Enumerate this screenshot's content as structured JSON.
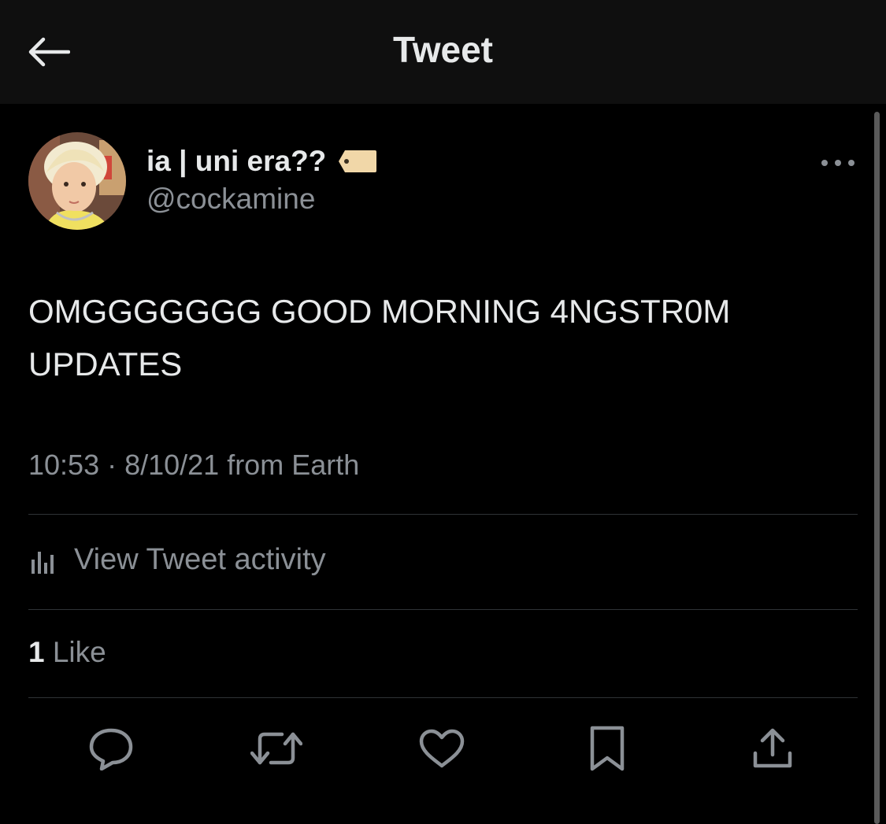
{
  "header": {
    "title": "Tweet",
    "back_icon": "arrow-left-icon"
  },
  "tweet": {
    "display_name": "ia | uni era??",
    "name_emoji": "tag-emoji",
    "handle": "@cockamine",
    "text": "OMGGGGGGG GOOD MORNING 4NGSTR0M UPDATES",
    "timestamp": "10:53 · 8/10/21 from Earth",
    "activity_label": "View Tweet activity",
    "like_count": "1",
    "like_label": "Like"
  },
  "actions": [
    "reply-icon",
    "retweet-icon",
    "like-icon",
    "bookmark-icon",
    "share-icon"
  ],
  "colors": {
    "background": "#000000",
    "header": "#0f0f0f",
    "primary_text": "#e7e9ea",
    "secondary_text": "#8b9096",
    "divider": "#2f3336"
  }
}
